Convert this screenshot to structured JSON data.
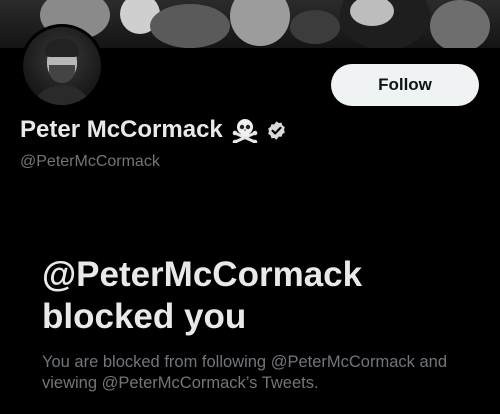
{
  "profile": {
    "display_name": "Peter McCormack",
    "name_emoji": "skull-and-crossbones",
    "verified": true,
    "handle": "@PeterMcCormack"
  },
  "actions": {
    "follow_label": "Follow"
  },
  "blocked": {
    "headline": "@PeterMcCormack blocked you",
    "description": "You are blocked from following @PeterMcCormack and viewing @PeterMcCormack’s Tweets."
  },
  "colors": {
    "background": "#000000",
    "primary_text": "#e7e9ea",
    "secondary_text": "#71767b",
    "button_bg": "#eff3f4",
    "button_text": "#0f1419"
  }
}
